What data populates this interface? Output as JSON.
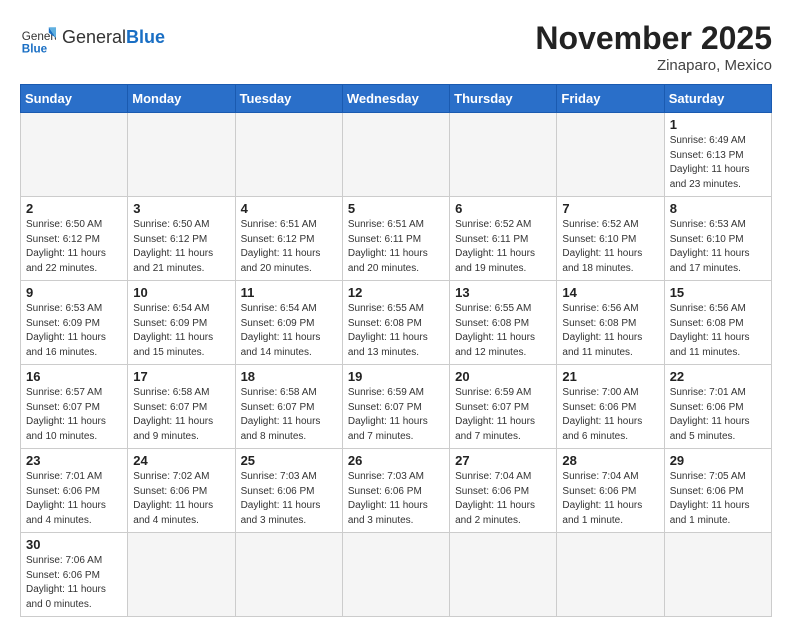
{
  "header": {
    "logo": {
      "general": "General",
      "blue": "Blue"
    },
    "title": "November 2025",
    "location": "Zinaparo, Mexico"
  },
  "weekdays": [
    "Sunday",
    "Monday",
    "Tuesday",
    "Wednesday",
    "Thursday",
    "Friday",
    "Saturday"
  ],
  "weeks": [
    [
      {
        "day": "",
        "info": ""
      },
      {
        "day": "",
        "info": ""
      },
      {
        "day": "",
        "info": ""
      },
      {
        "day": "",
        "info": ""
      },
      {
        "day": "",
        "info": ""
      },
      {
        "day": "",
        "info": ""
      },
      {
        "day": "1",
        "info": "Sunrise: 6:49 AM\nSunset: 6:13 PM\nDaylight: 11 hours\nand 23 minutes."
      }
    ],
    [
      {
        "day": "2",
        "info": "Sunrise: 6:50 AM\nSunset: 6:12 PM\nDaylight: 11 hours\nand 22 minutes."
      },
      {
        "day": "3",
        "info": "Sunrise: 6:50 AM\nSunset: 6:12 PM\nDaylight: 11 hours\nand 21 minutes."
      },
      {
        "day": "4",
        "info": "Sunrise: 6:51 AM\nSunset: 6:12 PM\nDaylight: 11 hours\nand 20 minutes."
      },
      {
        "day": "5",
        "info": "Sunrise: 6:51 AM\nSunset: 6:11 PM\nDaylight: 11 hours\nand 20 minutes."
      },
      {
        "day": "6",
        "info": "Sunrise: 6:52 AM\nSunset: 6:11 PM\nDaylight: 11 hours\nand 19 minutes."
      },
      {
        "day": "7",
        "info": "Sunrise: 6:52 AM\nSunset: 6:10 PM\nDaylight: 11 hours\nand 18 minutes."
      },
      {
        "day": "8",
        "info": "Sunrise: 6:53 AM\nSunset: 6:10 PM\nDaylight: 11 hours\nand 17 minutes."
      }
    ],
    [
      {
        "day": "9",
        "info": "Sunrise: 6:53 AM\nSunset: 6:09 PM\nDaylight: 11 hours\nand 16 minutes."
      },
      {
        "day": "10",
        "info": "Sunrise: 6:54 AM\nSunset: 6:09 PM\nDaylight: 11 hours\nand 15 minutes."
      },
      {
        "day": "11",
        "info": "Sunrise: 6:54 AM\nSunset: 6:09 PM\nDaylight: 11 hours\nand 14 minutes."
      },
      {
        "day": "12",
        "info": "Sunrise: 6:55 AM\nSunset: 6:08 PM\nDaylight: 11 hours\nand 13 minutes."
      },
      {
        "day": "13",
        "info": "Sunrise: 6:55 AM\nSunset: 6:08 PM\nDaylight: 11 hours\nand 12 minutes."
      },
      {
        "day": "14",
        "info": "Sunrise: 6:56 AM\nSunset: 6:08 PM\nDaylight: 11 hours\nand 11 minutes."
      },
      {
        "day": "15",
        "info": "Sunrise: 6:56 AM\nSunset: 6:08 PM\nDaylight: 11 hours\nand 11 minutes."
      }
    ],
    [
      {
        "day": "16",
        "info": "Sunrise: 6:57 AM\nSunset: 6:07 PM\nDaylight: 11 hours\nand 10 minutes."
      },
      {
        "day": "17",
        "info": "Sunrise: 6:58 AM\nSunset: 6:07 PM\nDaylight: 11 hours\nand 9 minutes."
      },
      {
        "day": "18",
        "info": "Sunrise: 6:58 AM\nSunset: 6:07 PM\nDaylight: 11 hours\nand 8 minutes."
      },
      {
        "day": "19",
        "info": "Sunrise: 6:59 AM\nSunset: 6:07 PM\nDaylight: 11 hours\nand 7 minutes."
      },
      {
        "day": "20",
        "info": "Sunrise: 6:59 AM\nSunset: 6:07 PM\nDaylight: 11 hours\nand 7 minutes."
      },
      {
        "day": "21",
        "info": "Sunrise: 7:00 AM\nSunset: 6:06 PM\nDaylight: 11 hours\nand 6 minutes."
      },
      {
        "day": "22",
        "info": "Sunrise: 7:01 AM\nSunset: 6:06 PM\nDaylight: 11 hours\nand 5 minutes."
      }
    ],
    [
      {
        "day": "23",
        "info": "Sunrise: 7:01 AM\nSunset: 6:06 PM\nDaylight: 11 hours\nand 4 minutes."
      },
      {
        "day": "24",
        "info": "Sunrise: 7:02 AM\nSunset: 6:06 PM\nDaylight: 11 hours\nand 4 minutes."
      },
      {
        "day": "25",
        "info": "Sunrise: 7:03 AM\nSunset: 6:06 PM\nDaylight: 11 hours\nand 3 minutes."
      },
      {
        "day": "26",
        "info": "Sunrise: 7:03 AM\nSunset: 6:06 PM\nDaylight: 11 hours\nand 3 minutes."
      },
      {
        "day": "27",
        "info": "Sunrise: 7:04 AM\nSunset: 6:06 PM\nDaylight: 11 hours\nand 2 minutes."
      },
      {
        "day": "28",
        "info": "Sunrise: 7:04 AM\nSunset: 6:06 PM\nDaylight: 11 hours\nand 1 minute."
      },
      {
        "day": "29",
        "info": "Sunrise: 7:05 AM\nSunset: 6:06 PM\nDaylight: 11 hours\nand 1 minute."
      }
    ],
    [
      {
        "day": "30",
        "info": "Sunrise: 7:06 AM\nSunset: 6:06 PM\nDaylight: 11 hours\nand 0 minutes."
      },
      {
        "day": "",
        "info": ""
      },
      {
        "day": "",
        "info": ""
      },
      {
        "day": "",
        "info": ""
      },
      {
        "day": "",
        "info": ""
      },
      {
        "day": "",
        "info": ""
      },
      {
        "day": "",
        "info": ""
      }
    ]
  ]
}
